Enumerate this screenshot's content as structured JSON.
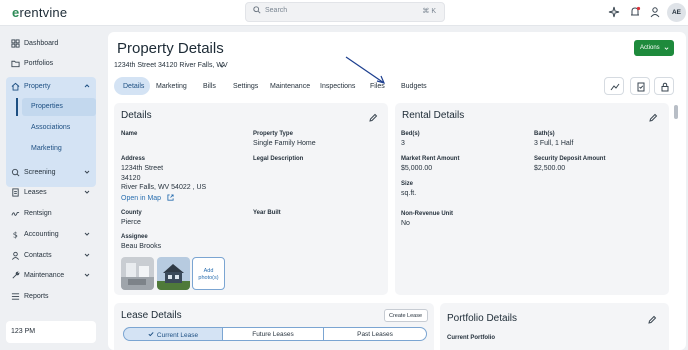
{
  "app": {
    "logo_text": "rentvine",
    "logo_mark": "e"
  },
  "search": {
    "placeholder": "Search",
    "shortcut": "⌘ K"
  },
  "user": {
    "initials": "AE"
  },
  "sidebar": {
    "items": [
      {
        "label": "Dashboard",
        "icon": "dashboard-icon"
      },
      {
        "label": "Portfolios",
        "icon": "folder-icon"
      },
      {
        "label": "Property",
        "icon": "house-icon"
      },
      {
        "label": "Screening",
        "icon": "screening-icon"
      },
      {
        "label": "Leases",
        "icon": "leases-icon"
      },
      {
        "label": "Rentsign",
        "icon": "signature-icon"
      },
      {
        "label": "Accounting",
        "icon": "dollar-icon"
      },
      {
        "label": "Contacts",
        "icon": "contacts-icon"
      },
      {
        "label": "Maintenance",
        "icon": "wrench-icon"
      },
      {
        "label": "Reports",
        "icon": "reports-icon"
      }
    ],
    "sub_items": [
      {
        "label": "Properties"
      },
      {
        "label": "Associations"
      },
      {
        "label": "Marketing"
      }
    ],
    "clock": "123 PM"
  },
  "page": {
    "title": "Property Details",
    "address": "1234th Street 34120 River Falls, WV",
    "actions_label": "Actions",
    "tabs": [
      "Details",
      "Marketing",
      "Bills",
      "Settings",
      "Maintenance",
      "Inspections",
      "Files",
      "Budgets"
    ]
  },
  "details": {
    "title": "Details",
    "name_label": "Name",
    "type_label": "Property Type",
    "type_value": "Single Family Home",
    "address_label": "Address",
    "address_line1": "1234th Street",
    "address_line2": "34120",
    "address_line3": "River Falls, WV 54022 , US",
    "legal_label": "Legal Description",
    "open_map": "Open in Map",
    "county_label": "County",
    "county_value": "Pierce",
    "year_label": "Year Built",
    "assignee_label": "Assignee",
    "assignee_value": "Beau Brooks",
    "add_photo": "Add photo(s)"
  },
  "rental": {
    "title": "Rental Details",
    "beds_label": "Bed(s)",
    "beds_value": "3",
    "baths_label": "Bath(s)",
    "baths_value": "3 Full, 1 Half",
    "market_rent_label": "Market Rent Amount",
    "market_rent_value": "$5,000.00",
    "deposit_label": "Security Deposit Amount",
    "deposit_value": "$2,500.00",
    "size_label": "Size",
    "size_value": "sq.ft.",
    "nonrev_label": "Non-Revenue Unit",
    "nonrev_value": "No"
  },
  "lease": {
    "title": "Lease Details",
    "create_label": "Create Lease",
    "segments": [
      "Current Lease",
      "Future Leases",
      "Past Leases"
    ]
  },
  "portfolio": {
    "title": "Portfolio Details",
    "current_label": "Current Portfolio"
  },
  "colors": {
    "accent": "#1d4f82",
    "primary_button": "#1e8a3c",
    "link": "#2a6fb0"
  }
}
